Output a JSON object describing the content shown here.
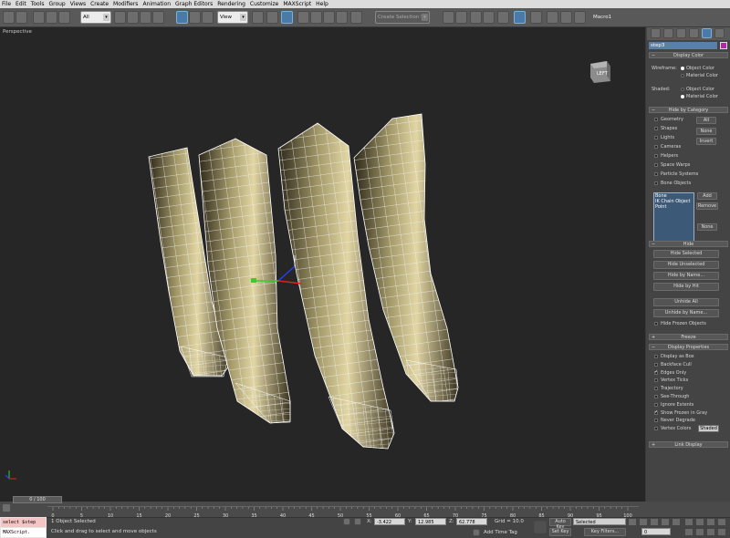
{
  "menu": [
    "File",
    "Edit",
    "Tools",
    "Group",
    "Views",
    "Create",
    "Modifiers",
    "Animation",
    "Graph Editors",
    "Rendering",
    "Customize",
    "MAXScript",
    "Help"
  ],
  "toolbar": {
    "filter_value": "All",
    "ref_coord": "View",
    "named_selection_placeholder": "Create Selection Se",
    "macro_label": "Macro1"
  },
  "viewport": {
    "label": "Perspective",
    "viewcube_label": "LEFT"
  },
  "command_panel": {
    "object_name": "step3",
    "object_color": "#b02aa7",
    "display_color": {
      "title": "Display Color",
      "wireframe_label": "Wireframe:",
      "shaded_label": "Shaded:",
      "object_color": "Object Color",
      "material_color": "Material Color"
    },
    "hide_by_category": {
      "title": "Hide by Category",
      "items": [
        "Geometry",
        "Shapes",
        "Lights",
        "Cameras",
        "Helpers",
        "Space Warps",
        "Particle Systems",
        "Bone Objects"
      ],
      "btn_all": "All",
      "btn_none": "None",
      "btn_invert": "Invert",
      "list_items": [
        "Bone",
        "IK Chain Object",
        "Point"
      ],
      "btn_add": "Add",
      "btn_remove": "Remove",
      "btn_none2": "None"
    },
    "hide": {
      "title": "Hide",
      "buttons": [
        "Hide Selected",
        "Hide Unselected",
        "Hide by Name...",
        "Hide by Hit"
      ],
      "unhide_buttons": [
        "Unhide All",
        "Unhide by Name..."
      ],
      "hide_frozen": "Hide Frozen Objects"
    },
    "freeze": {
      "title": "Freeze"
    },
    "display_properties": {
      "title": "Display Properties",
      "items": [
        {
          "label": "Display as Box",
          "checked": false
        },
        {
          "label": "Backface Cull",
          "checked": false
        },
        {
          "label": "Edges Only",
          "checked": true
        },
        {
          "label": "Vertex Ticks",
          "checked": false
        },
        {
          "label": "Trajectory",
          "checked": false
        },
        {
          "label": "See-Through",
          "checked": false
        },
        {
          "label": "Ignore Extents",
          "checked": false
        },
        {
          "label": "Show Frozen in Gray",
          "checked": true
        },
        {
          "label": "Never Degrade",
          "checked": false
        },
        {
          "label": "Vertex Colors",
          "checked": false
        }
      ],
      "shaded_btn": "Shaded"
    },
    "link_display": {
      "title": "Link Display"
    }
  },
  "timeline": {
    "frame_counter": "0 / 100",
    "ticks": [
      "0",
      "5",
      "10",
      "15",
      "20",
      "25",
      "30",
      "35",
      "40",
      "45",
      "50",
      "55",
      "60",
      "65",
      "70",
      "75",
      "80",
      "85",
      "90",
      "95",
      "100"
    ]
  },
  "status": {
    "script_line1": "select $step",
    "script_line2": "MAXScript.",
    "objects_selected": "1 Object Selected",
    "prompt": "Click and drag to select and move objects",
    "x_label": "X:",
    "x_value": "-3.422",
    "y_label": "Y:",
    "y_value": "12.985",
    "z_label": "Z:",
    "z_value": "62.778",
    "grid": "Grid = 10.0",
    "auto_key": "Auto Key",
    "set_key": "Set Key",
    "key_mode": "Selected",
    "key_filters": "Key Filters...",
    "add_time_tag": "Add Time Tag",
    "current_frame": "0"
  }
}
